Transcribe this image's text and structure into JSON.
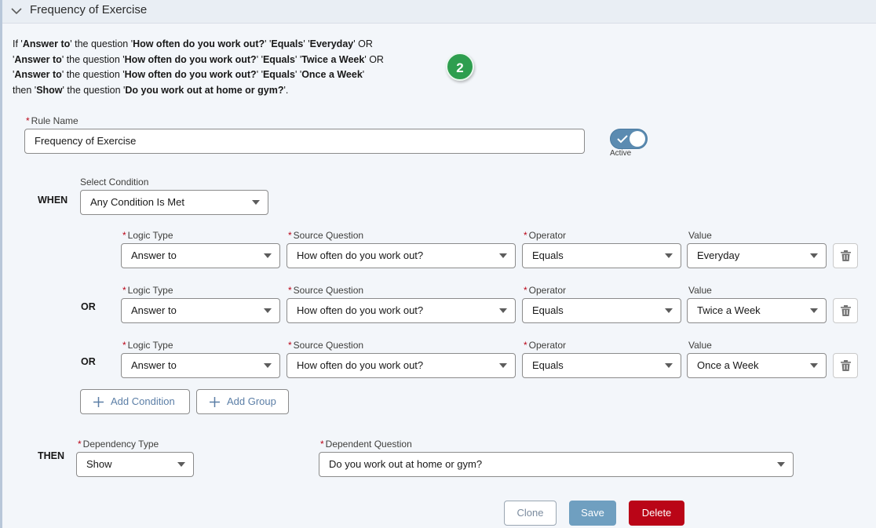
{
  "header": {
    "title": "Frequency of Exercise"
  },
  "summary": {
    "lines": [
      [
        {
          "t": "If '",
          "b": false
        },
        {
          "t": "Answer to",
          "b": true
        },
        {
          "t": "' the question '",
          "b": false
        },
        {
          "t": "How often do you work out?",
          "b": true
        },
        {
          "t": "' '",
          "b": false
        },
        {
          "t": "Equals",
          "b": true
        },
        {
          "t": "' '",
          "b": false
        },
        {
          "t": "Everyday",
          "b": true
        },
        {
          "t": "' OR",
          "b": false
        }
      ],
      [
        {
          "t": "'",
          "b": false
        },
        {
          "t": "Answer to",
          "b": true
        },
        {
          "t": "' the question '",
          "b": false
        },
        {
          "t": "How often do you work out?",
          "b": true
        },
        {
          "t": "' '",
          "b": false
        },
        {
          "t": "Equals",
          "b": true
        },
        {
          "t": "' '",
          "b": false
        },
        {
          "t": "Twice a Week",
          "b": true
        },
        {
          "t": "' OR",
          "b": false
        }
      ],
      [
        {
          "t": "'",
          "b": false
        },
        {
          "t": "Answer to",
          "b": true
        },
        {
          "t": "' the question '",
          "b": false
        },
        {
          "t": "How often do you work out?",
          "b": true
        },
        {
          "t": "' '",
          "b": false
        },
        {
          "t": "Equals",
          "b": true
        },
        {
          "t": "' '",
          "b": false
        },
        {
          "t": "Once a Week",
          "b": true
        },
        {
          "t": "'",
          "b": false
        }
      ],
      [
        {
          "t": "then '",
          "b": false
        },
        {
          "t": "Show",
          "b": true
        },
        {
          "t": "' the question '",
          "b": false
        },
        {
          "t": "Do you work out at home or gym?",
          "b": true
        },
        {
          "t": "'.",
          "b": false
        }
      ]
    ]
  },
  "step_badge": "2",
  "rule": {
    "name_label": "Rule Name",
    "name_value": "Frequency of Exercise",
    "active_label": "Active",
    "active": true
  },
  "when": {
    "keyword": "WHEN",
    "select_condition_label": "Select Condition",
    "select_condition_value": "Any Condition Is Met"
  },
  "condition_labels": {
    "logic_type": "Logic Type",
    "source_question": "Source Question",
    "operator": "Operator",
    "value": "Value"
  },
  "conditions": [
    {
      "connector": "",
      "logic_type": "Answer to",
      "source_question": "How often do you work out?",
      "operator": "Equals",
      "value": "Everyday"
    },
    {
      "connector": "OR",
      "logic_type": "Answer to",
      "source_question": "How often do you work out?",
      "operator": "Equals",
      "value": "Twice a Week"
    },
    {
      "connector": "OR",
      "logic_type": "Answer to",
      "source_question": "How often do you work out?",
      "operator": "Equals",
      "value": "Once a Week"
    }
  ],
  "add_buttons": {
    "add_condition": "Add Condition",
    "add_group": "Add Group"
  },
  "then": {
    "keyword": "THEN",
    "dependency_type_label": "Dependency Type",
    "dependency_type_value": "Show",
    "dependent_question_label": "Dependent Question",
    "dependent_question_value": "Do you work out at home or gym?"
  },
  "actions": {
    "clone": "Clone",
    "save": "Save",
    "delete": "Delete"
  },
  "colors": {
    "brand": "#5b8bb1",
    "danger": "#ba0517",
    "badge": "#2e9e4f"
  }
}
